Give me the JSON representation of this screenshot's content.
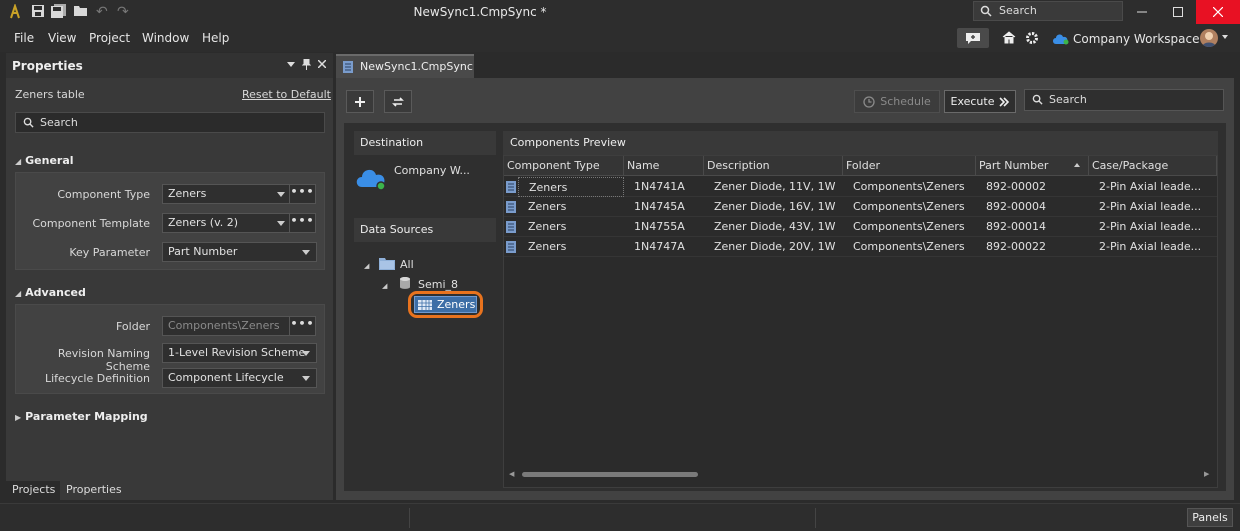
{
  "window": {
    "title": "NewSync1.CmpSync *",
    "search_placeholder": "Search"
  },
  "menu": [
    "File",
    "View",
    "Project",
    "Window",
    "Help"
  ],
  "workspace": {
    "label": "Company Workspace"
  },
  "properties": {
    "title": "Properties",
    "context_label": "Zeners table",
    "reset_link": "Reset to Default",
    "search_placeholder": "Search",
    "general": {
      "title": "General",
      "component_type_label": "Component Type",
      "component_type_value": "Zeners",
      "component_template_label": "Component Template",
      "component_template_value": "Zeners (v. 2)",
      "key_parameter_label": "Key Parameter",
      "key_parameter_value": "Part Number"
    },
    "advanced": {
      "title": "Advanced",
      "folder_label": "Folder",
      "folder_value": "Components\\Zeners",
      "revision_label": "Revision Naming Scheme",
      "revision_value": "1-Level Revision Scheme",
      "lifecycle_label": "Lifecycle Definition",
      "lifecycle_value": "Component Lifecycle"
    },
    "parameter_mapping": {
      "title": "Parameter Mapping"
    },
    "tabs": [
      "Projects",
      "Properties"
    ]
  },
  "document": {
    "tab_label": "NewSync1.CmpSync *",
    "schedule_label": "Schedule",
    "execute_label": "Execute",
    "search_placeholder": "Search",
    "destination": {
      "header": "Destination",
      "label": "Company W..."
    },
    "data_sources": {
      "header": "Data Sources",
      "tree": {
        "root": "All",
        "db": "Semi_8",
        "table": "Zeners"
      }
    },
    "preview": {
      "header": "Components Preview",
      "columns": [
        "Component Type",
        "Name",
        "Description",
        "Folder",
        "Part Number",
        "Case/Package"
      ],
      "rows": [
        [
          "Zeners",
          "1N4741A",
          "Zener Diode, 11V, 1W",
          "Components\\Zeners",
          "892-00002",
          "2-Pin Axial leade..."
        ],
        [
          "Zeners",
          "1N4745A",
          "Zener Diode, 16V, 1W",
          "Components\\Zeners",
          "892-00004",
          "2-Pin Axial leade..."
        ],
        [
          "Zeners",
          "1N4755A",
          "Zener Diode, 43V, 1W",
          "Components\\Zeners",
          "892-00014",
          "2-Pin Axial leade..."
        ],
        [
          "Zeners",
          "1N4747A",
          "Zener Diode, 20V, 1W",
          "Components\\Zeners",
          "892-00022",
          "2-Pin Axial leade..."
        ]
      ]
    }
  },
  "statusbar": {
    "panels_label": "Panels"
  },
  "colors": {
    "highlight_ring": "#e8731e",
    "selected_table": "#3d6ea6",
    "close_button": "#e81123"
  }
}
